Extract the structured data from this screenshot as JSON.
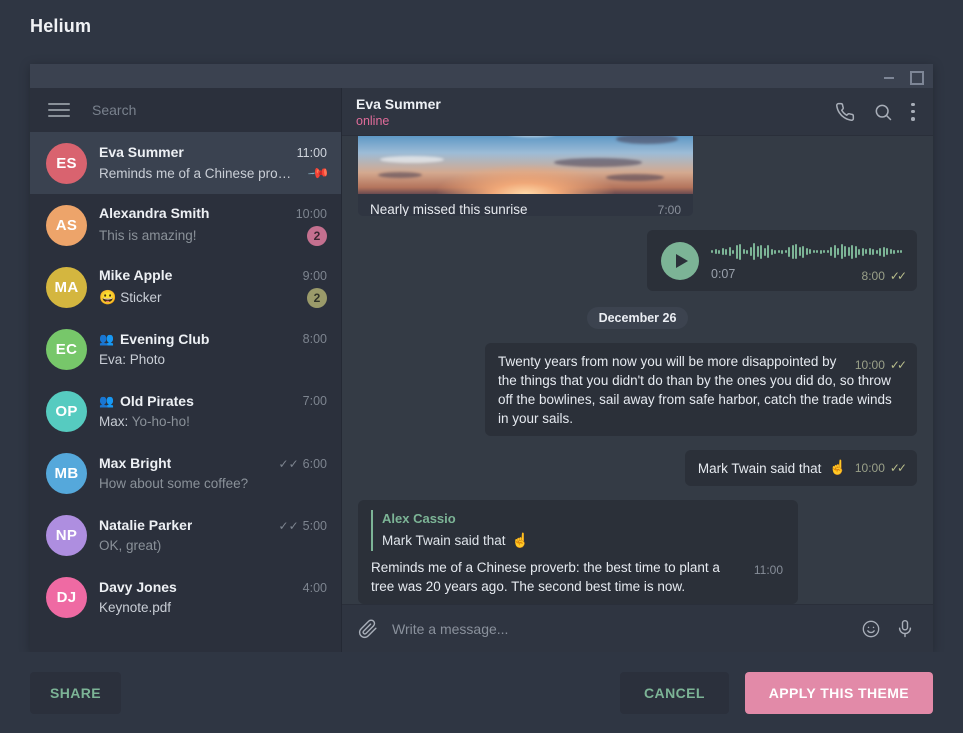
{
  "app": {
    "title": "Helium"
  },
  "window": {
    "minimize_label": "minimize",
    "maximize_label": "maximize"
  },
  "sidebar": {
    "menu_icon": "hamburger-icon",
    "search": {
      "placeholder": "Search",
      "value": "Search"
    },
    "chats": [
      {
        "initials": "ES",
        "color": "#d9636f",
        "name": "Eva Summer",
        "time": "11:00",
        "preview": "Reminds me of a Chinese pro…",
        "pinned": true,
        "active": true
      },
      {
        "initials": "AS",
        "color": "#eda46a",
        "name": "Alexandra Smith",
        "time": "10:00",
        "preview": "This is amazing!",
        "badge": "2",
        "badge_color": "#c4708f"
      },
      {
        "initials": "MA",
        "color": "#d4b63f",
        "name": "Mike Apple",
        "time": "9:00",
        "preview": "Sticker",
        "preview_emoji": "😀",
        "badge": "2",
        "badge_color": "#9a9a6a"
      },
      {
        "initials": "EC",
        "color": "#77c76a",
        "name": "Evening Club",
        "time": "8:00",
        "preview": "Eva: Photo",
        "preview_sender": "Eva:",
        "group": true
      },
      {
        "initials": "OP",
        "color": "#56cbc0",
        "name": "Old Pirates",
        "time": "7:00",
        "preview": "Yo-ho-ho!",
        "preview_sender": "Max:",
        "group": true
      },
      {
        "initials": "MB",
        "color": "#55a8db",
        "name": "Max Bright",
        "time": "6:00",
        "preview": "How about some coffee?",
        "ticks": true
      },
      {
        "initials": "NP",
        "color": "#ae8ee0",
        "name": "Natalie Parker",
        "time": "5:00",
        "preview": "OK, great)",
        "ticks": true
      },
      {
        "initials": "DJ",
        "color": "#ef6aa3",
        "name": "Davy Jones",
        "time": "4:00",
        "preview": "Keynote.pdf"
      }
    ]
  },
  "chat": {
    "header": {
      "name": "Eva Summer",
      "status": "online",
      "status_color": "#e06c9a",
      "call_icon": "phone-icon",
      "search_icon": "search-icon",
      "menu_icon": "more-vertical-icon"
    },
    "messages": [
      {
        "type": "photo",
        "caption": "Nearly missed this sunrise",
        "time": "7:00"
      },
      {
        "type": "voice",
        "duration": "0:07",
        "time": "8:00",
        "status": "read",
        "play_icon": "play-icon"
      },
      {
        "type": "date",
        "label": "December 26"
      },
      {
        "type": "text",
        "text": "Twenty years from now you will be more disappointed by the things that you didn't do than by the ones you did do, so throw off the bowlines, sail away from safe harbor, catch the trade winds in your sails.",
        "time": "10:00",
        "status": "read"
      },
      {
        "type": "text",
        "text": "Mark Twain said that",
        "emoji": "☝️",
        "time": "10:00",
        "status": "read"
      },
      {
        "type": "reply",
        "quote_name": "Alex Cassio",
        "quote_text": "Mark Twain said that",
        "quote_emoji": "☝️",
        "text": "Reminds me of a Chinese proverb: the best time to plant a tree was 20 years ago. The second best time is now.",
        "time": "11:00"
      }
    ],
    "composer": {
      "attach_icon": "paperclip-icon",
      "placeholder": "Write a message...",
      "emoji_icon": "smiley-icon",
      "mic_icon": "microphone-icon"
    }
  },
  "footer": {
    "share_label": "SHARE",
    "cancel_label": "CANCEL",
    "apply_label": "APPLY THIS THEME",
    "accent_color": "#e28aa8",
    "link_color": "#7cb496"
  }
}
